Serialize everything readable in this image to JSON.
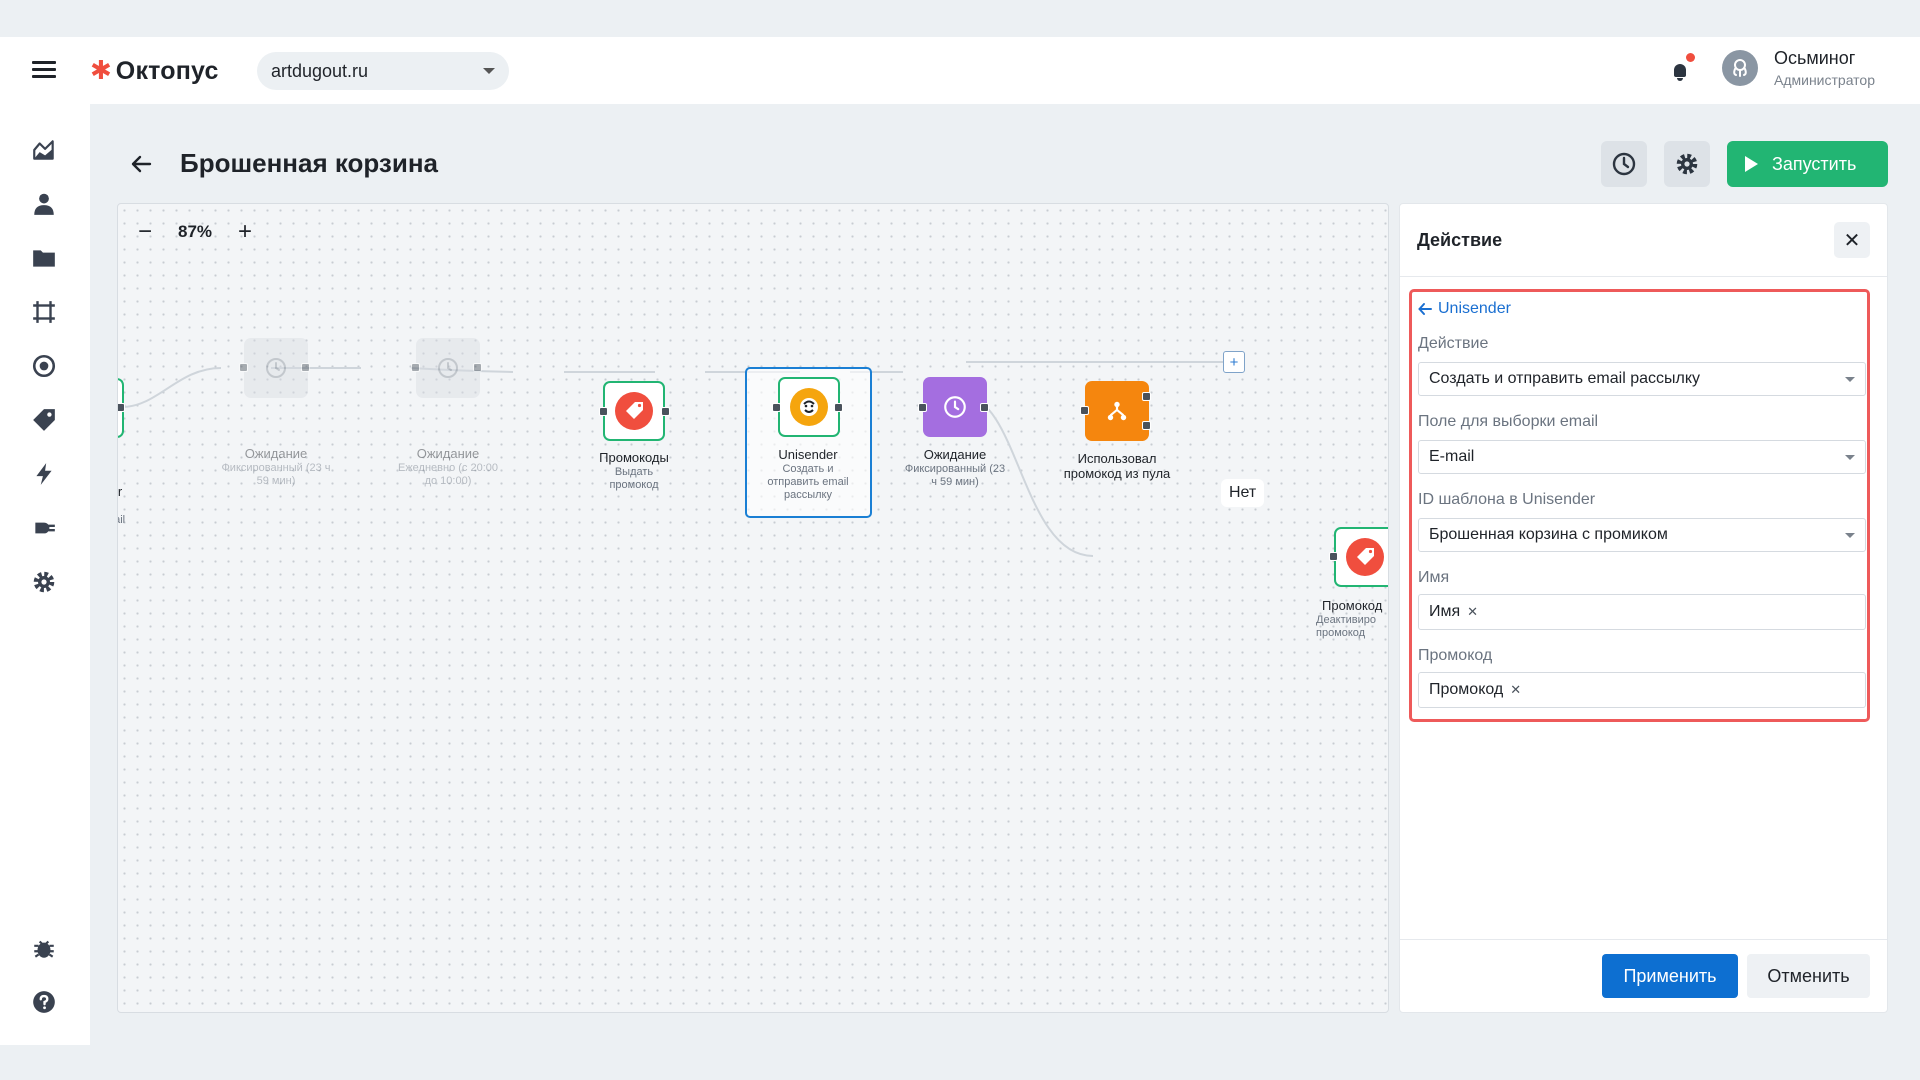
{
  "header": {
    "logo_text": "Октопус",
    "domain": "artdugout.ru",
    "user": {
      "name": "Осьминог",
      "role": "Администратор"
    }
  },
  "sidebar": {
    "icons": [
      "analytics-icon",
      "user-icon",
      "folder-icon",
      "segments-icon",
      "target-icon",
      "tag-icon",
      "lightning-icon",
      "plug-icon",
      "settings-icon",
      "bug-icon",
      "help-icon"
    ]
  },
  "page": {
    "title": "Брошенная корзина",
    "run_label": "Запустить"
  },
  "canvas": {
    "zoom": "87%",
    "nodes": [
      {
        "label": "",
        "sub": "nail"
      },
      {
        "label": "Ожидание",
        "sub": "Фиксированный (23 ч 59 мин)"
      },
      {
        "label": "Ожидание",
        "sub": "Ежедневно (с 20:00 до 10:00)"
      },
      {
        "label": "Промокоды",
        "sub": "Выдать промокод"
      },
      {
        "label": "Unisender",
        "sub": "Создать и отправить email рассылку"
      },
      {
        "label": "Ожидание",
        "sub": "Фиксированный (23 ч 59 мин)"
      },
      {
        "label": "Использовал промокод из пула",
        "sub": ""
      },
      {
        "label": "Промокод",
        "sub": "Деактивиро промокод"
      }
    ],
    "branch_label": "Нет",
    "colors": {
      "green": "#22b573",
      "purple": "#a46ee0",
      "orange": "#f5860e",
      "red": "#f04e3e",
      "selected": "#1a7fd4"
    }
  },
  "panel": {
    "title": "Действие",
    "back_label": "Unisender",
    "fields": {
      "action": {
        "label": "Действие",
        "value": "Создать и отправить email рассылку"
      },
      "email_field": {
        "label": "Поле для выборки email",
        "value": "E-mail"
      },
      "template": {
        "label": "ID шаблона в Unisender",
        "value": "Брошенная корзина с промиком"
      },
      "name": {
        "label": "Имя",
        "chip": "Имя"
      },
      "promo": {
        "label": "Промокод",
        "chip": "Промокод"
      }
    },
    "apply_label": "Применить",
    "cancel_label": "Отменить"
  }
}
